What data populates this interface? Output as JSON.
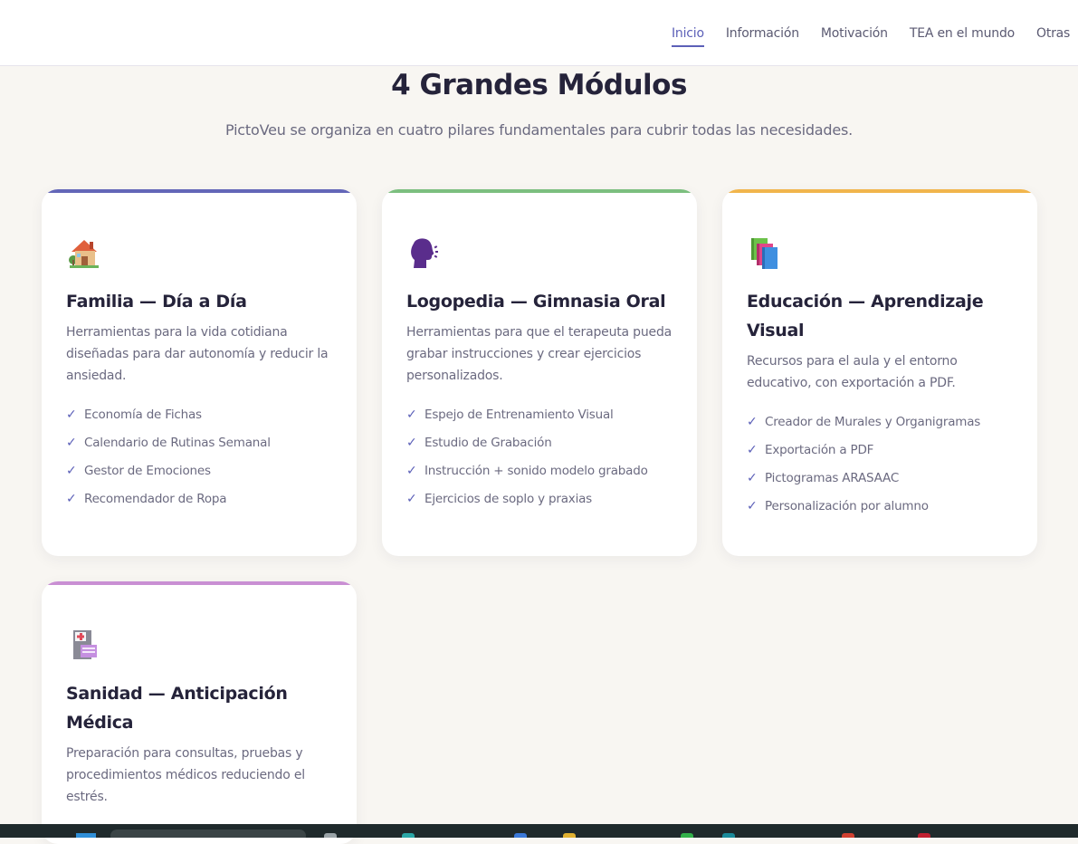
{
  "nav": {
    "items": [
      {
        "label": "Inicio",
        "active": true
      },
      {
        "label": "Información",
        "active": false
      },
      {
        "label": "Motivación",
        "active": false
      },
      {
        "label": "TEA en el mundo",
        "active": false
      },
      {
        "label": "Otras",
        "active": false
      }
    ]
  },
  "section": {
    "title": "4 Grandes Módulos",
    "subtitle": "PictoVeu se organiza en cuatro pilares fundamentales para cubrir todas las necesidades."
  },
  "modules": [
    {
      "icon": "house-icon",
      "accent": "#6366b8",
      "title": "Familia — Día a Día",
      "description": "Herramientas para la vida cotidiana diseñadas para dar autonomía y reducir la ansiedad.",
      "features": [
        "Economía de Fichas",
        "Calendario de Rutinas Semanal",
        "Gestor de Emociones",
        "Recomendador de Ropa"
      ]
    },
    {
      "icon": "speaking-head-icon",
      "accent": "#7cbf7f",
      "title": "Logopedia — Gimnasia Oral",
      "description": "Herramientas para que el terapeuta pueda grabar instrucciones y crear ejercicios personalizados.",
      "features": [
        "Espejo de Entrenamiento Visual",
        "Estudio de Grabación",
        "Instrucción + sonido modelo grabado",
        "Ejercicios de soplo y praxias"
      ]
    },
    {
      "icon": "books-icon",
      "accent": "#f1b54c",
      "title": "Educación — Aprendizaje Visual",
      "description": "Recursos para el aula y el entorno educativo, con exportación a PDF.",
      "features": [
        "Creador de Murales y Organigramas",
        "Exportación a PDF",
        "Pictogramas ARASAAC",
        "Personalización por alumno"
      ]
    },
    {
      "icon": "hospital-icon",
      "accent": "#c98fd3",
      "title": "Sanidad — Anticipación Médica",
      "description": "Preparación para consultas, pruebas y procedimientos médicos reduciendo el estrés.",
      "features": []
    }
  ],
  "check_glyph": "✓"
}
